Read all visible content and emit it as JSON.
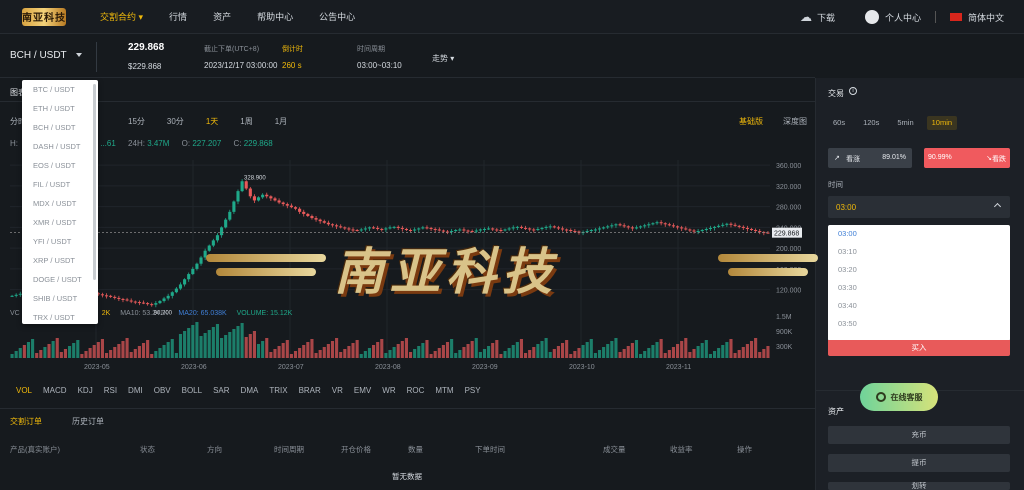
{
  "nav": {
    "logo": "南亚科技",
    "items": [
      {
        "label": "交割合约",
        "active": true
      },
      {
        "label": "行情"
      },
      {
        "label": "资产"
      },
      {
        "label": "帮助中心"
      },
      {
        "label": "公告中心"
      }
    ],
    "download": "下载",
    "personal": "个人中心",
    "language": "简体中文"
  },
  "ticker": {
    "pair": "BCH / USDT",
    "price": "229.868",
    "price_sub": "$229.868",
    "deadline_label": "截止下单(UTC+8)",
    "deadline_value": "2023/12/17 03:00:00",
    "countdown_label": "倒计时",
    "countdown_value": "260 s",
    "period_label": "时间周期",
    "period_value": "03:00~03:10",
    "trend": "走势"
  },
  "pair_list": [
    "BTC / USDT",
    "ETH / USDT",
    "BCH / USDT",
    "DASH / USDT",
    "EOS / USDT",
    "FIL / USDT",
    "MDX / USDT",
    "XMR / USDT",
    "YFI / USDT",
    "XRP / USDT",
    "DOGE / USDT",
    "SHIB / USDT",
    "TRX / USDT"
  ],
  "chart_header": {
    "title": "图表",
    "intervals": [
      "分时",
      "15分",
      "30分",
      "1天",
      "1周",
      "1月"
    ],
    "active_interval": "1天",
    "style_basic": "基础版",
    "style_depth": "深度图",
    "ohlc": {
      "h_label": "H:",
      "h": "...61",
      "vol_label": "24H:",
      "vol": "3.47M",
      "o_label": "O:",
      "o": "227.207",
      "c_label": "C:",
      "c": "229.868"
    },
    "ma": {
      "v_prefix": "VC",
      "ma5": "2K",
      "ma10": "MA10: 53.241K",
      "ma20": "MA20: 65.038K",
      "volume": "VOLUME: 15.12K"
    }
  },
  "chart_data": {
    "type": "candlestick",
    "xlabels": [
      "2023-05",
      "2023-06",
      "2023-07",
      "2023-08",
      "2023-09",
      "2023-10",
      "2023-11"
    ],
    "ylabels": [
      "360.000",
      "320.000",
      "280.000",
      "240.000",
      "200.000",
      "160.000",
      "120.000"
    ],
    "vol_labels": [
      "1.5M",
      "900K",
      "300K"
    ],
    "high_marker": "328.900",
    "low_marker": "90.700",
    "last_price": "229.868",
    "ylim": [
      100,
      370
    ],
    "series": [
      {
        "name": "close",
        "values": [
          108,
          110,
          112,
          109,
          111,
          114,
          113,
          112,
          116,
          114,
          118,
          117,
          116,
          115,
          117,
          119,
          122,
          120,
          118,
          116,
          113,
          111,
          109,
          108,
          106,
          104,
          102,
          101,
          99,
          97,
          96,
          95,
          94,
          92,
          91,
          94,
          98,
          103,
          108,
          115,
          122,
          130,
          140,
          150,
          160,
          170,
          182,
          195,
          205,
          215,
          225,
          240,
          255,
          270,
          290,
          310,
          329,
          315,
          300,
          292,
          298,
          303,
          300,
          296,
          292,
          288,
          285,
          282,
          279,
          276,
          270,
          266,
          262,
          258,
          255,
          252,
          249,
          246,
          244,
          242,
          240,
          238,
          236,
          235,
          234,
          236,
          238,
          240,
          239,
          237,
          236,
          238,
          240,
          241,
          239,
          237,
          235,
          234,
          236,
          238,
          240,
          239,
          237,
          236,
          234,
          232,
          231,
          233,
          235,
          236,
          234,
          233,
          232,
          234,
          236,
          237,
          238,
          236,
          235,
          234,
          236,
          238,
          240,
          241,
          239,
          238,
          236,
          235,
          237,
          239,
          241,
          242,
          240,
          238,
          236,
          235,
          233,
          232,
          230,
          231,
          233,
          235,
          236,
          238,
          240,
          242,
          244,
          246,
          244,
          242,
          240,
          238,
          240,
          242,
          244,
          246,
          248,
          250,
          248,
          246,
          244,
          242,
          240,
          238,
          236,
          234,
          232,
          233,
          235,
          237,
          239,
          241,
          243,
          245,
          247,
          245,
          243,
          241,
          239,
          237,
          235,
          233,
          231,
          230,
          229.868
        ]
      }
    ]
  },
  "indicators": [
    "VOL",
    "MACD",
    "KDJ",
    "RSI",
    "DMI",
    "OBV",
    "BOLL",
    "SAR",
    "DMA",
    "TRIX",
    "BRAR",
    "VR",
    "EMV",
    "WR",
    "ROC",
    "MTM",
    "PSY"
  ],
  "orders": {
    "tabs": [
      "交割订单",
      "历史订单"
    ],
    "columns": [
      "产品(真实账户)",
      "状态",
      "方向",
      "时间周期",
      "开仓价格",
      "数量",
      "下单时间",
      "成交量",
      "收益率",
      "操作"
    ],
    "empty": "暂无数据"
  },
  "trade_panel": {
    "title": "交易",
    "durations": [
      "60s",
      "120s",
      "5min",
      "10min"
    ],
    "selected_duration": "10min",
    "up_label": "看涨",
    "up_pct": "89.01%",
    "down_label": "看跌",
    "down_pct": "90.99%",
    "time_label": "时间",
    "time_value": "03:00",
    "time_options": [
      "03:00",
      "03:10",
      "03:20",
      "03:30",
      "03:40",
      "03:50"
    ],
    "buy": "买入",
    "assets_title": "资产",
    "deposit": "充币",
    "withdraw": "提币",
    "transfer": "划转"
  },
  "service": "在线客服",
  "watermark": "南亚科技",
  "colors": {
    "accent": "#f0b90b",
    "up": "#1fa98a",
    "down": "#e85a5a"
  }
}
